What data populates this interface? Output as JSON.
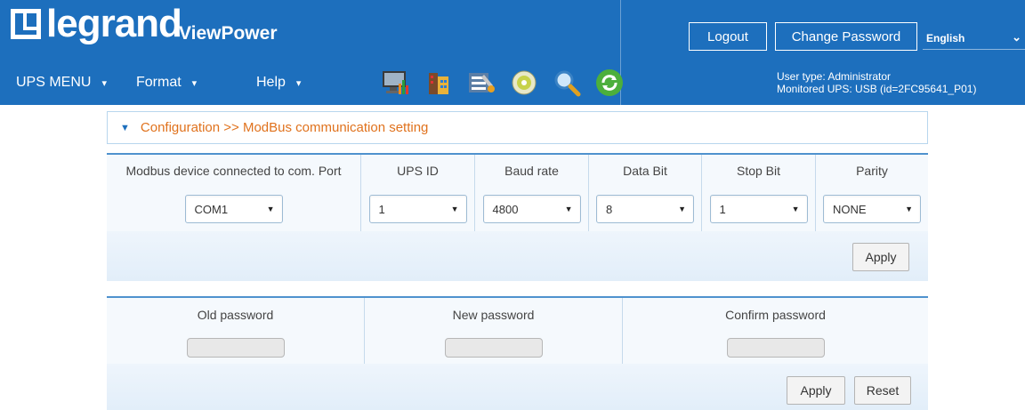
{
  "header": {
    "logo": "legrand",
    "product": "ViewPower",
    "logout": "Logout",
    "change_password": "Change Password",
    "language": "English",
    "user_type": "User type: Administrator",
    "monitored_ups": "Monitored UPS: USB (id=2FC95641_P01)",
    "brand_color": "#1d6fbd"
  },
  "menu": {
    "ups_menu": "UPS MENU",
    "format": "Format",
    "help": "Help"
  },
  "toolbar_icons": [
    "monitor-chart-icon",
    "building-icon",
    "tools-icon",
    "disc-icon",
    "magnifier-icon",
    "refresh-icon"
  ],
  "breadcrumb": "Configuration >> ModBus communication setting",
  "modbus": {
    "headers": [
      "Modbus device connected to com. Port",
      "UPS ID",
      "Baud rate",
      "Data Bit",
      "Stop Bit",
      "Parity"
    ],
    "values": [
      "COM1",
      "1",
      "4800",
      "8",
      "1",
      "NONE"
    ],
    "apply": "Apply"
  },
  "password": {
    "headers": [
      "Old password",
      "New password",
      "Confirm password"
    ],
    "apply": "Apply",
    "reset": "Reset"
  }
}
